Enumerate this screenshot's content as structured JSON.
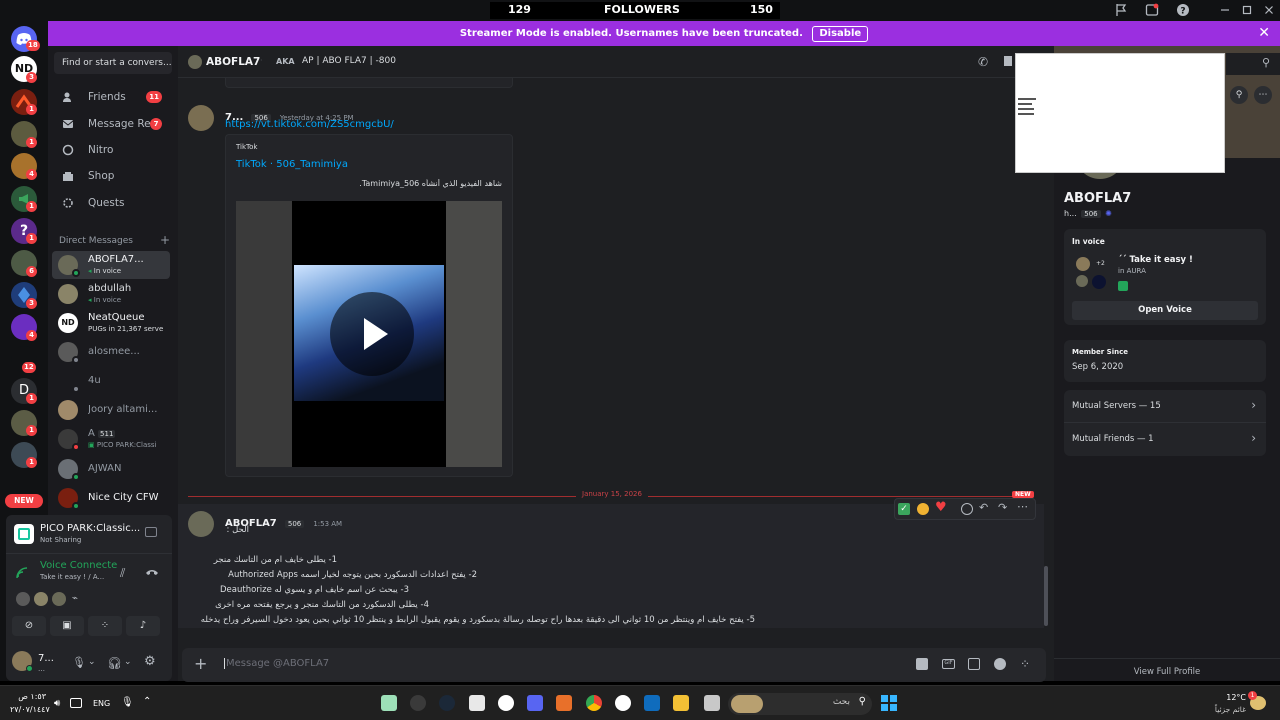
{
  "titlebar": {
    "left_count": "129",
    "center_label": "FOLLOWERS",
    "right_count": "150"
  },
  "banner": {
    "text": "Streamer Mode is enabled. Usernames have been truncated.",
    "button": "Disable"
  },
  "rail": {
    "badges": [
      "18",
      "3",
      "1",
      "1",
      "4",
      "1",
      "1",
      "6",
      "3",
      "4",
      "12",
      "1",
      "1",
      "1"
    ],
    "new_label": "NEW",
    "srv_letter_p": "?",
    "srv_letter_d": "D"
  },
  "sidebar": {
    "search_placeholder": "Find or start a convers...",
    "nav": [
      {
        "label": "Friends",
        "count": "11",
        "icon": "friends-icon"
      },
      {
        "label": "Message Re...",
        "count": "7",
        "icon": "envelope-icon"
      },
      {
        "label": "Nitro",
        "count": "",
        "icon": "nitro-icon"
      },
      {
        "label": "Shop",
        "count": "",
        "icon": "shop-icon"
      },
      {
        "label": "Quests",
        "count": "",
        "icon": "quests-icon"
      }
    ],
    "dm_header": "Direct Messages",
    "dms": [
      {
        "name": "ABOFLA7...",
        "sub": "In voice",
        "active": true
      },
      {
        "name": "abdullah",
        "sub": "In voice"
      },
      {
        "name": "NeatQueue",
        "sub": "PUGs in 21,367 serve"
      },
      {
        "name": "alosmee...",
        "sub": ""
      },
      {
        "name": "4u",
        "sub": ""
      },
      {
        "name": "Joory altami...",
        "sub": ""
      },
      {
        "name": "A",
        "tag": "511",
        "sub": "PICO PARK:Classi"
      },
      {
        "name": "AJWAN",
        "sub": ""
      },
      {
        "name": "Nice City CFW",
        "sub": ""
      }
    ]
  },
  "panel": {
    "activity_title": "PICO PARK:Classic...",
    "activity_sub": "Not Sharing",
    "voice_title": "Voice Connecte",
    "voice_sub": "Take it easy ! / A...",
    "user_name": "7...",
    "user_sub": "…"
  },
  "chat": {
    "header_name": "ABOFLA7",
    "header_aka_label": "AKA",
    "header_aka": "AP | ABO FLA7 | -800",
    "msg1": {
      "name": "7...",
      "tag": "506",
      "time": "Yesterday at 4:25 PM",
      "link": "https://vt.tiktok.com/ZS5cmgcbU/",
      "embed_provider": "TikTok",
      "embed_title": "TikTok · 506_Tamimiya",
      "embed_desc": "شاهد الفيديو الذي أنشأه Tamimiya_506."
    },
    "divider_date": "January 15, 2026",
    "divider_new": "NEW",
    "msg2": {
      "name": "ABOFLA7",
      "tag": "506",
      "time": "1:53 AM",
      "lines": [
        "الحل :",
        "1- يطلى خايف ام من التاسك منجر",
        "2- يفتح اعدادات الدسكورد بحين يتوجه لخيار اسمه Authorized Apps",
        "3- يبحث عن اسم خايف ام و يسوي له Deauthorize",
        "4- يطلى الدسكورد من التاسك منجر و يرجع يفتحه مره اخرى",
        "5- يفتح خايف ام وينتظر من 10 ثواني الى دقيقة بعدها راح توصله رسالة بدسكورد و يقوم يقبول الرابط و ينتظر 10 ثواني بحين يعود دخول السيرفر وراح يدخله"
      ]
    },
    "composer_placeholder": "Message @ABOFLA7"
  },
  "profile": {
    "name": "ABOFLA7",
    "sub": "h...",
    "tag": "506",
    "in_voice_label": "In voice",
    "voice_count": "+2",
    "voice_channel": "´´ Take it easy !",
    "voice_server": "in AURA",
    "open_voice": "Open Voice",
    "member_since_label": "Member Since",
    "member_since": "Sep 6, 2020",
    "mutual_servers": "Mutual Servers — 15",
    "mutual_friends": "Mutual Friends — 1",
    "view_full": "View Full Profile"
  },
  "taskbar": {
    "time": "١:٥٣ ص",
    "date": "٢٧/٠٧/١٤٤٧",
    "lang": "ENG",
    "search_placeholder": "بحث",
    "weather_temp": "12°C",
    "weather_desc": "غائم جزئياً",
    "weather_badge": "1"
  },
  "colors": {
    "accent": "#5865f2",
    "banner": "#9b2fe0",
    "danger": "#f23f43",
    "online": "#23a55a",
    "link": "#00a8fc"
  }
}
